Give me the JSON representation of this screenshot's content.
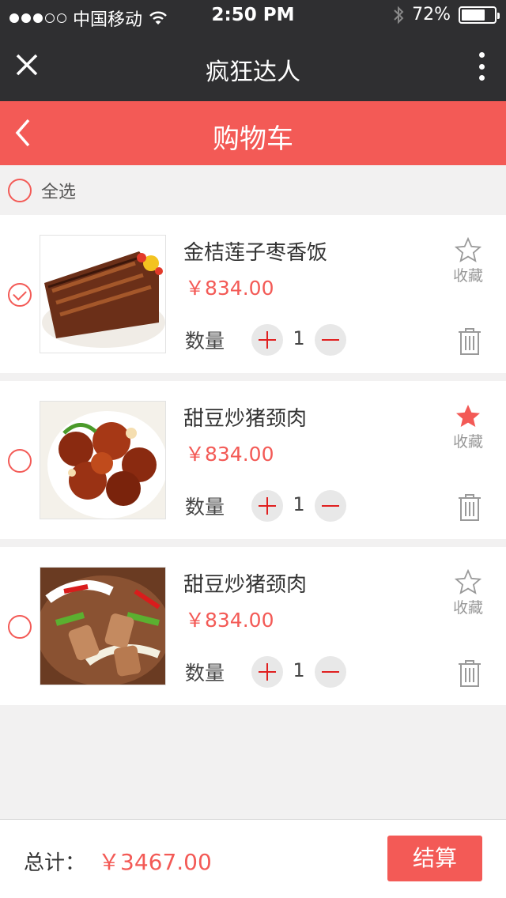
{
  "status_bar": {
    "carrier": "中国移动",
    "time": "2:50 PM",
    "battery_text": "72%",
    "battery_level": 0.72
  },
  "wechat_nav": {
    "title": "疯狂达人"
  },
  "header": {
    "title": "购物车"
  },
  "select_all": {
    "label": "全选",
    "checked": false
  },
  "items": [
    {
      "name": "金桔莲子枣香饭",
      "price": "￥834.00",
      "qty_label": "数量",
      "qty": "1",
      "fav_label": "收藏",
      "favorited": false,
      "checked": true,
      "image": "braised-pork-dish"
    },
    {
      "name": "甜豆炒猪颈肉",
      "price": "￥834.00",
      "qty_label": "数量",
      "qty": "1",
      "fav_label": "收藏",
      "favorited": true,
      "checked": false,
      "image": "red-braised-pork-dish"
    },
    {
      "name": "甜豆炒猪颈肉",
      "price": "￥834.00",
      "qty_label": "数量",
      "qty": "1",
      "fav_label": "收藏",
      "favorited": false,
      "checked": false,
      "image": "squid-stir-fry-dish"
    }
  ],
  "footer": {
    "total_label": "总计：",
    "total_value": "￥3467.00",
    "checkout_label": "结算"
  },
  "colors": {
    "accent": "#f35a56",
    "dark_bar": "#2f2f31"
  }
}
